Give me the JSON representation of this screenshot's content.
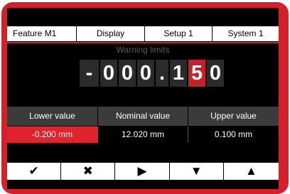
{
  "tabs": [
    {
      "label": "Feature  M1",
      "active": true
    },
    {
      "label": "Display",
      "active": false
    },
    {
      "label": "Setup 1",
      "active": false
    },
    {
      "label": "System 1",
      "active": false
    }
  ],
  "section_title": "Warning limits",
  "reading": {
    "sign": "-",
    "chars": [
      "0",
      "0",
      "0",
      ".",
      "1",
      "5",
      "0"
    ],
    "highlighted_index": 5
  },
  "table": {
    "headers": [
      "Lower value",
      "Nominal value",
      "Upper value"
    ],
    "values": [
      "-0.200 mm",
      "12.020 mm",
      "0.100 mm"
    ],
    "selected_index": 0
  },
  "softkeys": [
    {
      "icon": "check-icon",
      "glyph": "✔"
    },
    {
      "icon": "cross-icon",
      "glyph": "✖"
    },
    {
      "icon": "play-right-icon",
      "glyph": "▶"
    },
    {
      "icon": "down-arrow-icon",
      "glyph": "▼"
    },
    {
      "icon": "up-arrow-icon",
      "glyph": "▲"
    }
  ],
  "colors": {
    "accent": "#d4202b",
    "selected": "#e0242e"
  }
}
